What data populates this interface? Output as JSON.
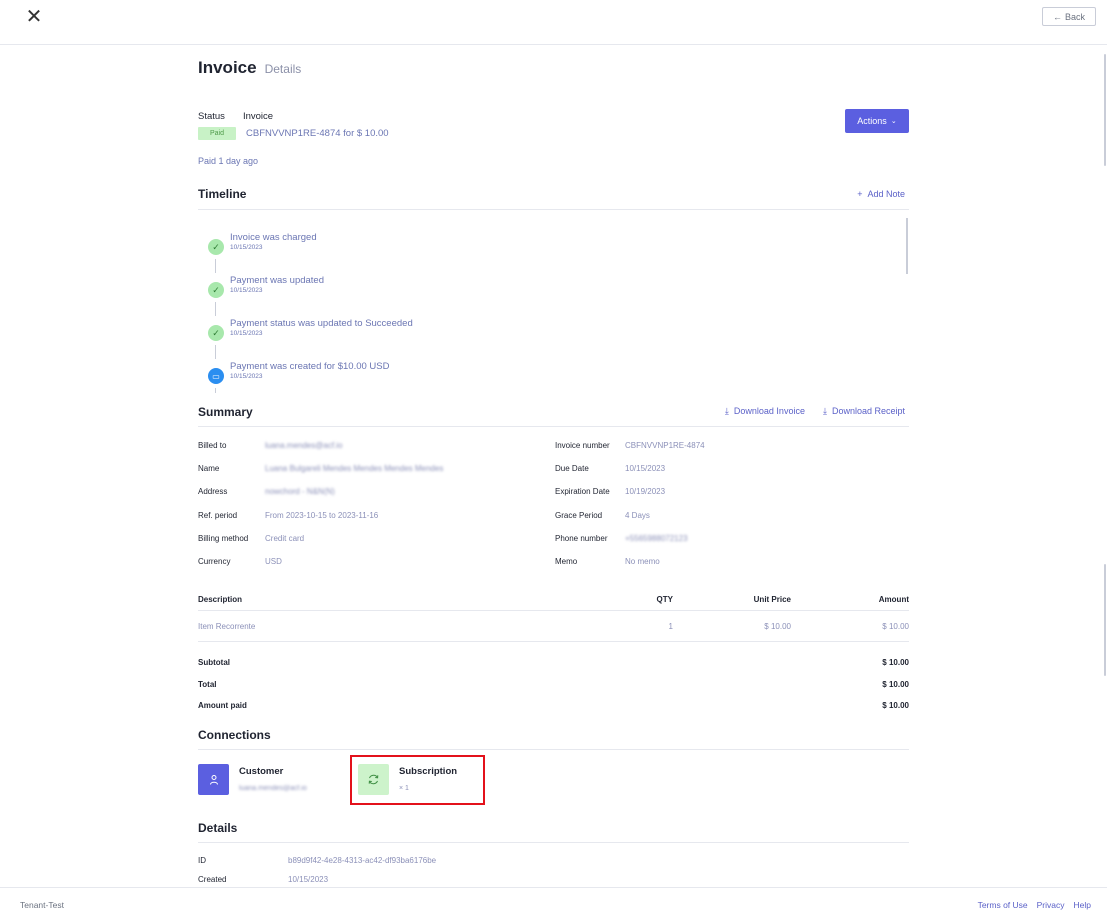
{
  "topbar": {
    "close_glyph": "✕",
    "back_label": "Back",
    "back_icon": "arrow-left-icon"
  },
  "page": {
    "title": "Invoice",
    "subtitle": "Details"
  },
  "status": {
    "label_status": "Status",
    "label_invoice": "Invoice",
    "badge": "Paid",
    "invoice_ref": "CBFNVVNP1RE-4874 for $ 10.00",
    "paid_ago": "Paid 1 day ago",
    "actions_label": "Actions"
  },
  "timeline": {
    "title": "Timeline",
    "add_note": "Add Note",
    "items": [
      {
        "title": "Invoice was charged",
        "date": "10/15/2023",
        "icon": "check-icon"
      },
      {
        "title": "Payment was updated",
        "date": "10/15/2023",
        "icon": "check-icon"
      },
      {
        "title": "Payment status was updated to Succeeded",
        "date": "10/15/2023",
        "icon": "check-icon"
      },
      {
        "title": "Payment was created for $10.00 USD",
        "date": "10/15/2023",
        "icon": "credit-card-icon"
      }
    ]
  },
  "summary": {
    "title": "Summary",
    "download_invoice": "Download Invoice",
    "download_receipt": "Download Receipt",
    "left": [
      {
        "key": "Billed to",
        "value": "luana.mendes@acf.io",
        "blurred": true
      },
      {
        "key": "Name",
        "value": "Luana Bulgareli Mendes Mendes Mendes Mendes",
        "blurred": true
      },
      {
        "key": "Address",
        "value": "nowchord - N&N(N)",
        "blurred": true
      },
      {
        "key": "Ref. period",
        "value": "From 2023-10-15 to 2023-11-16",
        "blurred": false
      },
      {
        "key": "Billing method",
        "value": "Credit card",
        "blurred": false
      },
      {
        "key": "Currency",
        "value": "USD",
        "blurred": false
      }
    ],
    "right": [
      {
        "key": "Invoice number",
        "value": "CBFNVVNP1RE-4874",
        "blurred": false
      },
      {
        "key": "Due Date",
        "value": "10/15/2023",
        "blurred": false
      },
      {
        "key": "Expiration Date",
        "value": "10/19/2023",
        "blurred": false
      },
      {
        "key": "Grace Period",
        "value": "4 Days",
        "blurred": false
      },
      {
        "key": "Phone number",
        "value": "+5565988072123",
        "blurred": true
      },
      {
        "key": "Memo",
        "value": "No memo",
        "blurred": false
      }
    ]
  },
  "items": {
    "headers": [
      "Description",
      "QTY",
      "Unit Price",
      "Amount"
    ],
    "rows": [
      {
        "description": "Item Recorrente",
        "qty": "1",
        "unit_price": "$ 10.00",
        "amount": "$ 10.00"
      }
    ]
  },
  "totals": [
    {
      "label": "Subtotal",
      "value": "$ 10.00"
    },
    {
      "label": "Total",
      "value": "$ 10.00"
    },
    {
      "label": "Amount paid",
      "value": "$ 10.00"
    }
  ],
  "connections": {
    "title": "Connections",
    "customer": {
      "title": "Customer",
      "sub": "luana.mendes@acf.io",
      "icon": "user-icon",
      "color": "#5b5fe0"
    },
    "subscription": {
      "title": "Subscription",
      "sub": "× 1",
      "icon": "refresh-icon",
      "color": "#cdf3cb"
    }
  },
  "details": {
    "title": "Details",
    "rows": [
      {
        "key": "ID",
        "value": "b89d9f42-4e28-4313-ac42-df93ba6176be"
      },
      {
        "key": "Created",
        "value": "10/15/2023"
      }
    ]
  },
  "footer": {
    "tenant": "Tenant-Test",
    "terms": "Terms of Use",
    "privacy": "Privacy",
    "help": "Help"
  },
  "colors": {
    "accent": "#5b5fe0",
    "link": "#5b61c8",
    "paid_badge_bg": "#c8f2c6",
    "highlight": "#e3111b"
  }
}
